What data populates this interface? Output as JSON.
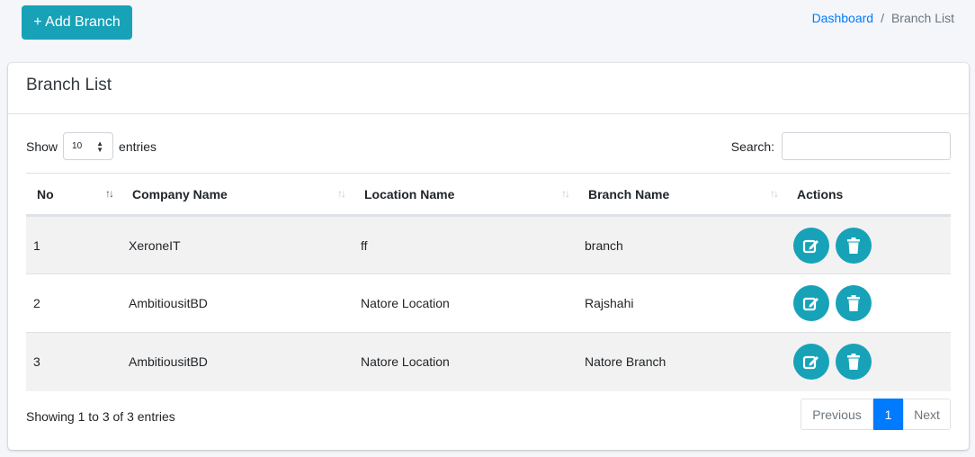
{
  "header": {
    "add_button": "+ Add Branch",
    "breadcrumb": {
      "link": "Dashboard",
      "separator": "/",
      "current": "Branch List"
    }
  },
  "card": {
    "title": "Branch List",
    "show_label": "Show",
    "entries_label": "entries",
    "length_value": "10",
    "search_label": "Search:",
    "search_value": ""
  },
  "table": {
    "columns": [
      "No",
      "Company Name",
      "Location Name",
      "Branch Name",
      "Actions"
    ],
    "rows": [
      [
        "1",
        "XeroneIT",
        "ff",
        "branch"
      ],
      [
        "2",
        "AmbitiousitBD",
        "Natore Location",
        "Rajshahi"
      ],
      [
        "3",
        "AmbitiousitBD",
        "Natore Location",
        "Natore Branch"
      ]
    ]
  },
  "footer": {
    "info": "Showing 1 to 3 of 3 entries",
    "previous": "Previous",
    "page": "1",
    "next": "Next"
  },
  "colors": {
    "accent": "#17a2b8",
    "primary": "#007bff"
  },
  "icons": {
    "edit": "edit-icon",
    "delete": "trash-icon"
  }
}
